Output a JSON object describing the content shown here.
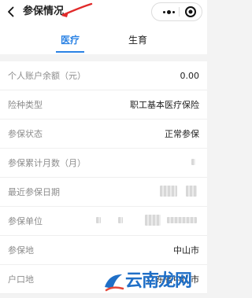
{
  "header": {
    "title": "参保情况"
  },
  "tabs": [
    {
      "label": "医疗",
      "active": true
    },
    {
      "label": "生育",
      "active": false
    }
  ],
  "rows": [
    {
      "label": "个人账户余额（元）",
      "value": "0.00"
    },
    {
      "label": "险种类型",
      "value": "职工基本医疗保险"
    },
    {
      "label": "参保状态",
      "value": "正常参保"
    },
    {
      "label": "参保累计月数（月）",
      "value": ""
    },
    {
      "label": "最近参保日期",
      "value": ""
    },
    {
      "label": "参保单位",
      "value": ""
    },
    {
      "label": "参保地",
      "value": "中山市"
    },
    {
      "label": "户口地",
      "value": "广东省中山市"
    }
  ],
  "watermark": {
    "text": "云南龙网"
  },
  "colors": {
    "accent": "#2a82e4",
    "annotation": "#e12a2a"
  }
}
